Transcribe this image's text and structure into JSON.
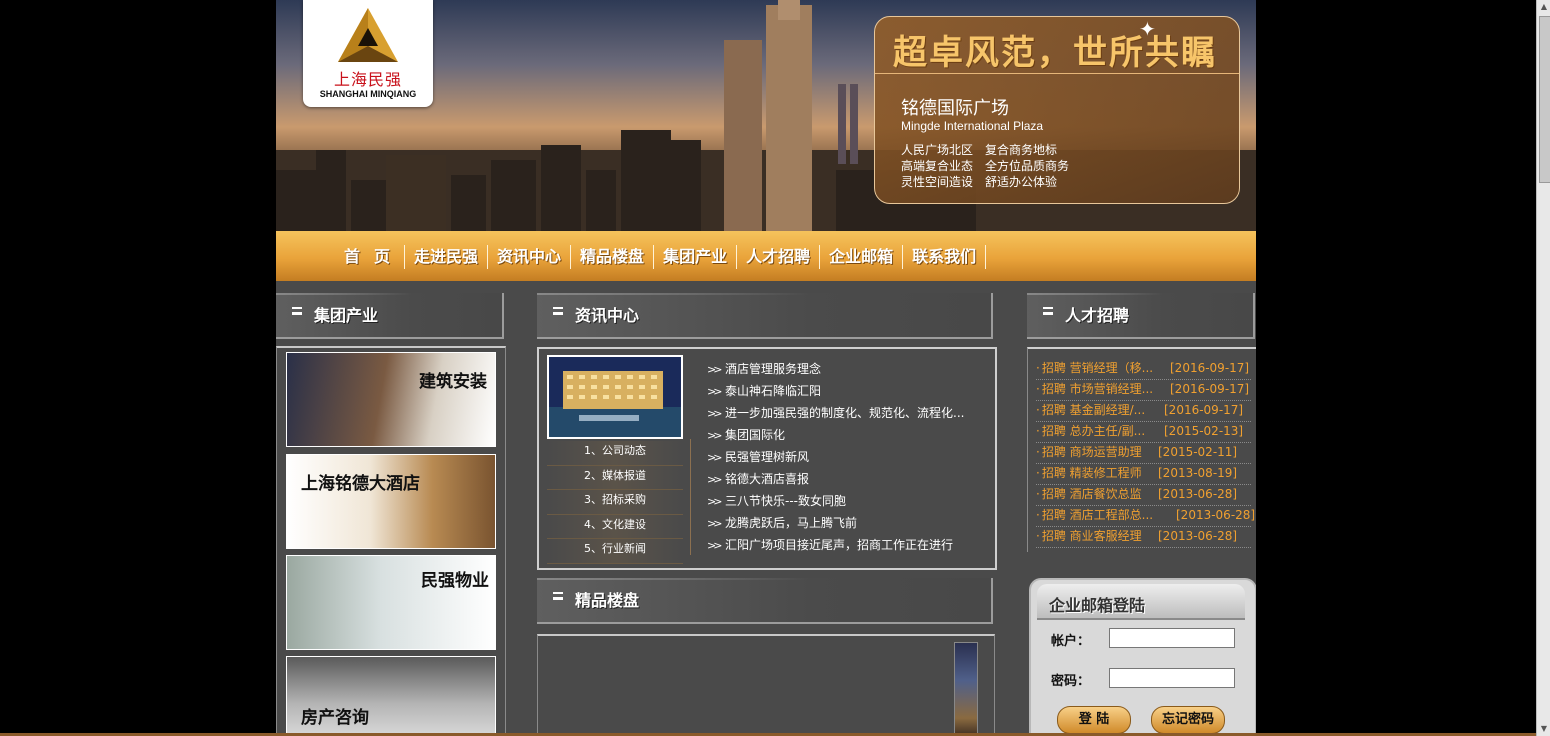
{
  "logo": {
    "cn": "上海民强",
    "en": "SHANGHAI MINQIANG"
  },
  "banner": {
    "slogan": "超卓风范，世所共瞩",
    "title": "铭德国际广场",
    "subtitle": "Mingde International Plaza",
    "features": [
      [
        "人民广场北区",
        "复合商务地标"
      ],
      [
        "高端复合业态",
        "全方位品质商务"
      ],
      [
        "灵性空间造设",
        "舒适办公体验"
      ]
    ]
  },
  "nav": [
    "首页",
    "走进民强",
    "资讯中心",
    "精品楼盘",
    "集团产业",
    "人才招聘",
    "企业邮箱",
    "联系我们"
  ],
  "sections": {
    "industry": "集团产业",
    "news": "资讯中心",
    "properties": "精品楼盘",
    "jobs": "人才招聘"
  },
  "industry_cards": [
    "建筑安装",
    "上海铭德大酒店",
    "民强物业",
    "房产咨询"
  ],
  "news_categories": [
    "1、公司动态",
    "2、媒体报道",
    "3、招标采购",
    "4、文化建设",
    "5、行业新闻"
  ],
  "news_items": [
    "酒店管理服务理念",
    "泰山神石降临汇阳",
    "进一步加强民强的制度化、规范化、流程化...",
    "集团国际化",
    "民强管理树新风",
    "铭德大酒店喜报",
    "三八节快乐---致女同胞",
    "龙腾虎跃后，马上腾飞前",
    "汇阳广场项目接近尾声，招商工作正在进行"
  ],
  "jobs": [
    {
      "title": "招聘 营销经理（移...",
      "date": "[2016-09-17]"
    },
    {
      "title": "招聘 市场营销经理...",
      "date": "[2016-09-17]"
    },
    {
      "title": "招聘 基金副经理/...",
      "date": "[2016-09-17]"
    },
    {
      "title": "招聘 总办主任/副...",
      "date": "[2015-02-13]"
    },
    {
      "title": "招聘 商场运营助理",
      "date": "[2015-02-11]"
    },
    {
      "title": "招聘 精装修工程师",
      "date": "[2013-08-19]"
    },
    {
      "title": "招聘 酒店餐饮总监",
      "date": "[2013-06-28]"
    },
    {
      "title": "招聘 酒店工程部总...",
      "date": "[2013-06-28]"
    },
    {
      "title": "招聘 商业客服经理",
      "date": "[2013-06-28]"
    }
  ],
  "login": {
    "title": "企业邮箱登陆",
    "account_label": "帐户：",
    "password_label": "密码：",
    "account_value": "",
    "password_value": "",
    "login_button": "登 陆",
    "forgot_button": "忘记密码"
  },
  "colors": {
    "accent": "#e9a33a",
    "job_text": "#f0a030",
    "page_bg": "#4a4a4a"
  }
}
